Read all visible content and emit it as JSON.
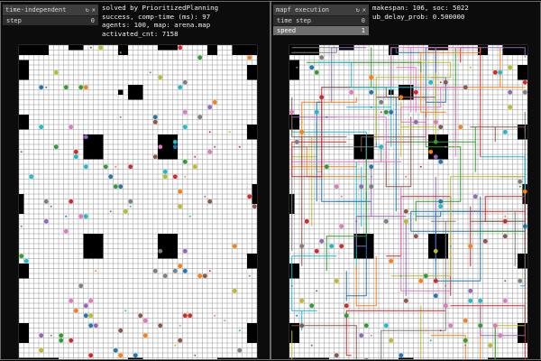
{
  "left_panel": {
    "window": {
      "title": "time-independent",
      "step_label": "step",
      "step_value": "0"
    },
    "info": {
      "line1": "solved by PrioritizedPlanning",
      "line2": "success, comp-time (ms): 97",
      "line3": "agents: 100, map: arena.map",
      "line4": "activated_cnt: 7158"
    }
  },
  "right_panel": {
    "window": {
      "title": "mapf execution",
      "time_step_label": "time step",
      "time_step_value": "0",
      "speed_label": "speed",
      "speed_value": "1"
    },
    "info": {
      "line1": "makespan: 106, soc: 5022",
      "line2": "ub_delay_prob: 0.500000"
    }
  },
  "colors": {
    "background": "#000000",
    "grid_cell": "#ffffff",
    "grid_line": "#8c8c8c",
    "obstacle": "#000000",
    "agent_palette": [
      "#1f77b4",
      "#ff7f0e",
      "#2ca02c",
      "#d62728",
      "#9467bd",
      "#8c564b",
      "#e377c2",
      "#7f7f7f",
      "#bcbd22",
      "#17becf"
    ]
  },
  "icons": {
    "window_buttons": [
      "collapse-icon",
      "close-icon"
    ]
  }
}
